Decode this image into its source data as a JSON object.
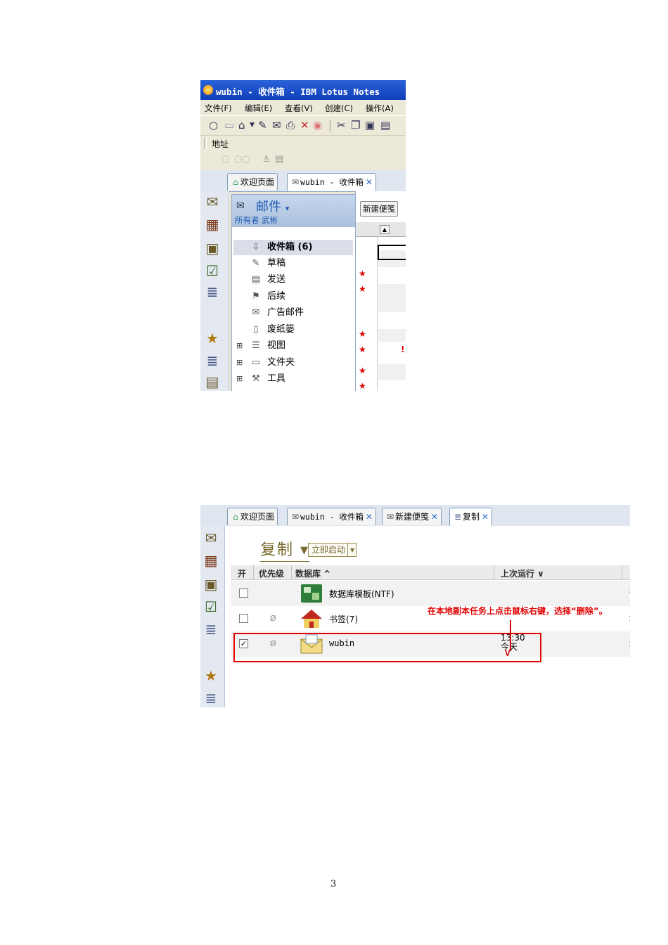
{
  "shot1": {
    "window_title": "wubin - 收件箱 - IBM Lotus Notes",
    "menu": [
      "文件(F)",
      "编辑(E)",
      "查看(V)",
      "创建(C)",
      "操作(A)"
    ],
    "address_label": "地址",
    "tabs": [
      {
        "label": "欢迎页面",
        "icon": "home-icon"
      },
      {
        "label": "wubin - 收件箱",
        "icon": "mail-icon",
        "closable": true
      }
    ],
    "nav": {
      "title": "邮件",
      "owner": "所有者 武彬",
      "items": [
        {
          "label": "收件箱 (6)",
          "icon": "inbox-icon",
          "selected": true
        },
        {
          "label": "草稿",
          "icon": "draft-icon"
        },
        {
          "label": "发送",
          "icon": "sent-icon"
        },
        {
          "label": "后续",
          "icon": "followup-icon"
        },
        {
          "label": "广告邮件",
          "icon": "junk-icon"
        },
        {
          "label": "废纸篓",
          "icon": "trash-icon"
        },
        {
          "label": "视图",
          "icon": "view-icon",
          "expandable": true
        },
        {
          "label": "文件夹",
          "icon": "folder-icon",
          "expandable": true
        },
        {
          "label": "工具",
          "icon": "tools-icon",
          "expandable": true
        }
      ]
    },
    "new_memo_button": "新建便笺",
    "accent": "#e00000"
  },
  "para1": "",
  "para2": "",
  "shot2": {
    "tabs": [
      {
        "label": "欢迎页面",
        "icon": "home-icon"
      },
      {
        "label": "wubin - 收件箱",
        "icon": "mail-icon",
        "closable": true
      },
      {
        "label": "新建便笺",
        "icon": "memo-icon",
        "closable": true
      },
      {
        "label": "复制",
        "icon": "replicate-icon",
        "closable": true
      }
    ],
    "title": "复制 ▾",
    "start_button": "立即启动",
    "columns": [
      "开",
      "优先级",
      "数据库 ^",
      "上次运行 ∨"
    ],
    "rows": [
      {
        "checked": false,
        "priority": "",
        "name": "数据库模板(NTF)",
        "last_run_time": "",
        "last_run_day": "",
        "icon": "template-icon"
      },
      {
        "checked": false,
        "priority": "Ø",
        "name": "书签(7)",
        "last_run_time": "",
        "last_run_day": "",
        "icon": "bookmark-house-icon"
      },
      {
        "checked": true,
        "priority": "Ø",
        "name": "wubin",
        "last_run_time": "13:30",
        "last_run_day": "今天",
        "icon": "mail-envelope-icon"
      }
    ],
    "annotation": "在本地副本任务上点击鼠标右键，选择“删除”。",
    "edge_mark": ":"
  },
  "page_number": "3"
}
